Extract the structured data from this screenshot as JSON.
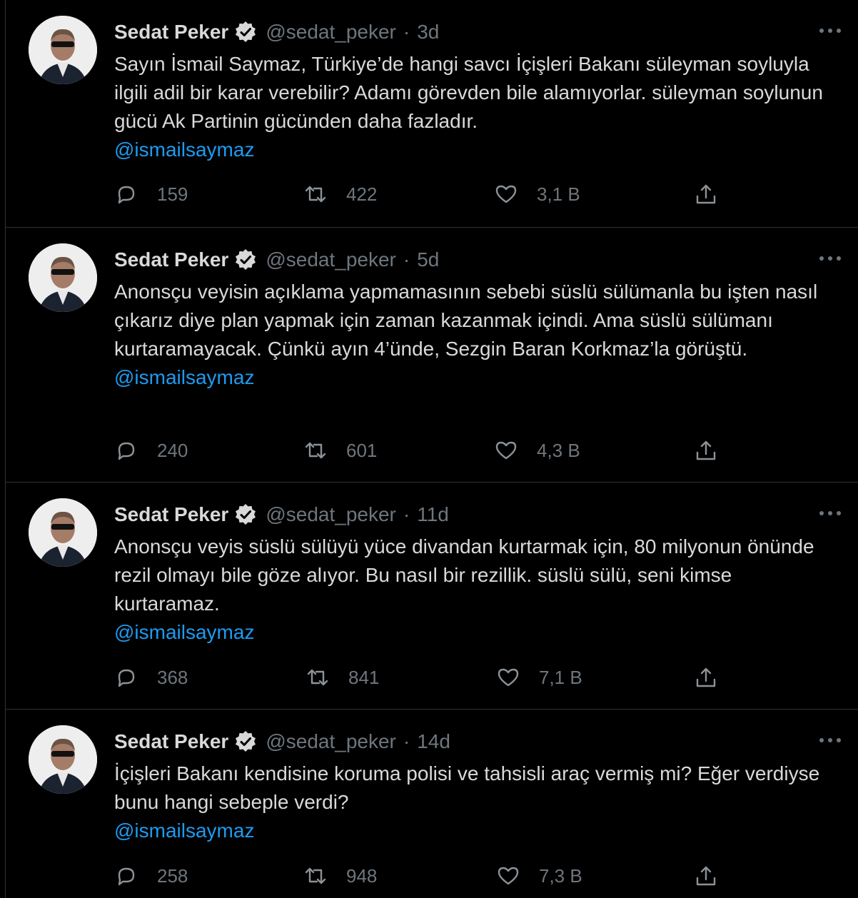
{
  "tweets": [
    {
      "name": "Sedat Peker",
      "handle": "@sedat_peker",
      "separator": "·",
      "time": "3d",
      "text": "Sayın İsmail Saymaz, Türkiye’de hangi savcı İçişleri Bakanı süleyman soyluyla ilgili adil bir karar verebilir? Adamı görevden bile alamıyorlar. süleyman soylunun gücü Ak Partinin gücünden daha fazladır.",
      "mention": "@ismailsaymaz",
      "replies": "159",
      "retweets": "422",
      "likes": "3,1 B"
    },
    {
      "name": "Sedat Peker",
      "handle": "@sedat_peker",
      "separator": "·",
      "time": "5d",
      "text": "Anonsçu veyisin açıklama yapmamasının sebebi süslü sülümanla bu işten nasıl çıkarız diye plan yapmak için zaman kazanmak içindi. Ama süslü sülümanı kurtaramayacak. Çünkü ayın 4’ünde, Sezgin Baran Korkmaz’la görüştü.",
      "mention": "@ismailsaymaz",
      "replies": "240",
      "retweets": "601",
      "likes": "4,3 B"
    },
    {
      "name": "Sedat Peker",
      "handle": "@sedat_peker",
      "separator": "·",
      "time": "11d",
      "text": "Anonsçu veyis süslü sülüyü yüce divandan kurtarmak için, 80 milyonun önünde rezil olmayı bile göze alıyor. Bu nasıl bir rezillik. süslü sülü, seni kimse kurtaramaz.",
      "mention": "@ismailsaymaz",
      "replies": "368",
      "retweets": "841",
      "likes": "7,1 B"
    },
    {
      "name": "Sedat Peker",
      "handle": "@sedat_peker",
      "separator": "·",
      "time": "14d",
      "text": "İçişleri Bakanı kendisine koruma polisi ve tahsisli araç vermiş mi? Eğer verdiyse bunu hangi sebeple verdi?",
      "mention": "@ismailsaymaz",
      "replies": "258",
      "retweets": "948",
      "likes": "7,3 B"
    }
  ],
  "colors": {
    "background": "#000000",
    "text": "#d9d9d9",
    "secondary": "#6e767d",
    "link": "#1d9bf0",
    "border": "#2f3336"
  },
  "icons": [
    "verified-badge-icon",
    "more-icon",
    "reply-icon",
    "retweet-icon",
    "like-icon",
    "share-icon"
  ]
}
